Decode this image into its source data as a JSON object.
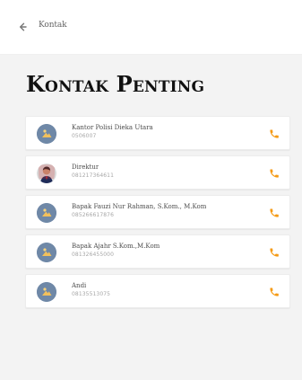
{
  "header": {
    "back_icon": "back-arrow-icon",
    "title": "Kontak"
  },
  "page": {
    "title": "Kontak Penting"
  },
  "contacts": [
    {
      "name": "Kantor Polisi Dieka Utara",
      "phone": "0506007",
      "avatar_icon": "avatar-placeholder-icon",
      "call_icon": "phone-icon"
    },
    {
      "name": "Direktur",
      "phone": "081217364611",
      "avatar_icon": "avatar-photo-icon",
      "call_icon": "phone-icon"
    },
    {
      "name": "Bapak Fauzi Nur Rahman, S.Kom., M.Kom",
      "phone": "085266617876",
      "avatar_icon": "avatar-placeholder-icon",
      "call_icon": "phone-icon"
    },
    {
      "name": "Bapak Ajahr S.Kom.,M.Kom",
      "phone": "081326455000",
      "avatar_icon": "avatar-placeholder-icon",
      "call_icon": "phone-icon"
    },
    {
      "name": "Andi",
      "phone": "08135513075",
      "avatar_icon": "avatar-placeholder-icon",
      "call_icon": "phone-icon"
    }
  ],
  "colors": {
    "background": "#f3f3f3",
    "card": "#ffffff",
    "accent_phone": "#f59a14",
    "avatar_blue": "#6f88a7",
    "avatar_person_red": "#cc2b2b"
  }
}
